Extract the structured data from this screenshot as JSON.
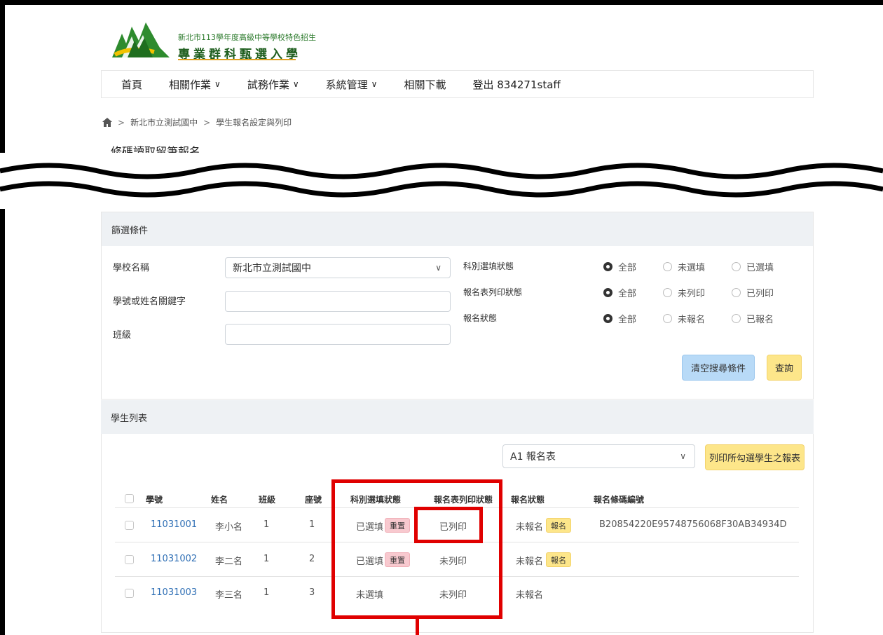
{
  "header": {
    "logo_line1": "新北市113學年度高級中等學校特色招生",
    "logo_line2": "專業群科甄選入學"
  },
  "nav": {
    "items": [
      {
        "label": "首頁",
        "dropdown": false
      },
      {
        "label": "相關作業",
        "dropdown": true
      },
      {
        "label": "試務作業",
        "dropdown": true
      },
      {
        "label": "系統管理",
        "dropdown": true
      },
      {
        "label": "相關下載",
        "dropdown": false
      },
      {
        "label": "登出 834271staff",
        "dropdown": false
      }
    ]
  },
  "breadcrumb": {
    "items": [
      "新北市立測試國中",
      "學生報名設定與列印"
    ],
    "separator": ">"
  },
  "page_title": "修碼讀取留筆報名",
  "filter": {
    "title": "篩選條件",
    "school_label": "學校名稱",
    "school_value": "新北市立測試國中",
    "keyword_label": "學號或姓名關鍵字",
    "keyword_value": "",
    "class_label": "班級",
    "class_value": "",
    "radio_groups": [
      {
        "label": "科別選填狀態",
        "options": [
          "全部",
          "未選填",
          "已選填"
        ],
        "selected": 0
      },
      {
        "label": "報名表列印狀態",
        "options": [
          "全部",
          "未列印",
          "已列印"
        ],
        "selected": 0
      },
      {
        "label": "報名狀態",
        "options": [
          "全部",
          "未報名",
          "已報名"
        ],
        "selected": 0
      }
    ],
    "clear_button": "清空搜尋條件",
    "search_button": "查詢"
  },
  "list": {
    "title": "學生列表",
    "form_select": "A1 報名表",
    "print_button": "列印所勾選學生之報表",
    "columns": [
      "學號",
      "姓名",
      "班級",
      "座號",
      "科別選填狀態",
      "報名表列印狀態",
      "報名狀態",
      "報名條碼編號"
    ],
    "rows": [
      {
        "id": "11031001",
        "name": "李小名",
        "class": "1",
        "seat": "1",
        "select_status": "已選填",
        "reset_badge": "重置",
        "print_status": "已列印",
        "reg_status": "未報名",
        "reg_badge": "報名",
        "barcode": "B20854220E95748756068F30AB34934D"
      },
      {
        "id": "11031002",
        "name": "李二名",
        "class": "1",
        "seat": "2",
        "select_status": "已選填",
        "reset_badge": "重置",
        "print_status": "未列印",
        "reg_status": "未報名",
        "reg_badge": "報名",
        "barcode": ""
      },
      {
        "id": "11031003",
        "name": "李三名",
        "class": "1",
        "seat": "3",
        "select_status": "未選填",
        "reset_badge": "",
        "print_status": "未列印",
        "reg_status": "未報名",
        "reg_badge": "",
        "barcode": ""
      }
    ]
  },
  "colors": {
    "accent_red": "#e00000",
    "link_blue": "#2f6fb5",
    "badge_pink": "#f8c9cf",
    "badge_yellow": "#fde68a",
    "button_blue": "#b8daf7",
    "panel_header": "#eef1f4"
  }
}
